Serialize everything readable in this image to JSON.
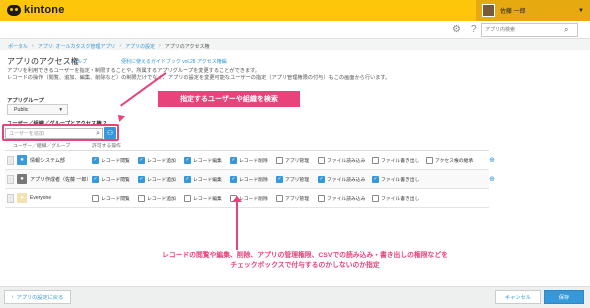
{
  "app": {
    "logo_text": "kintone"
  },
  "user": {
    "name": "佐藤 一郎",
    "caret": "▼"
  },
  "search": {
    "placeholder": "アプリ内検索",
    "icon": "search-icon"
  },
  "breadcrumb": {
    "items": [
      "ポータル",
      "アプリ: オールカタスク管理アプリ",
      "アプリの設定",
      "アプリのアクセス権"
    ],
    "separator": "›"
  },
  "page": {
    "title": "アプリのアクセス権",
    "help_link": "ヘルプ",
    "guide_link": "便利に使えるガイドブック vol.28 アクセス権編",
    "description_line1": "アプリを利用できるユーザーを指定・制限することや、所属するアプリグループを変更することができます。",
    "description_line2": "レコードの操作（閲覧、追加、編集、削除など）の制限だけでなく、アプリの設定を変更可能なユーザーの指定（アプリ管理権限の付与）もこの画面から行います。"
  },
  "app_group": {
    "label": "アプリグループ",
    "value": "Public",
    "caret": "▾"
  },
  "access_section": {
    "label": "ユーザー／組織／グループとアクセス権 ?"
  },
  "user_search": {
    "placeholder": "ユーザーを追加",
    "icon": "search-icon"
  },
  "callout1": "指定するユーザーや組織を検索",
  "table": {
    "headers": [
      "ユーザー／組織／グループ",
      "許可する操作"
    ],
    "rows": [
      {
        "name": "情報システム部",
        "icon_color": "#3d9ad8",
        "perms": [
          {
            "label": "レコード閲覧",
            "checked": true
          },
          {
            "label": "レコード追加",
            "checked": true
          },
          {
            "label": "レコード編集",
            "checked": true
          },
          {
            "label": "レコード削除",
            "checked": true
          },
          {
            "label": "アプリ管理",
            "checked": false
          },
          {
            "label": "ファイル読み込み",
            "checked": false
          },
          {
            "label": "ファイル書き出し",
            "checked": false
          },
          {
            "label": "アクセス権の継承",
            "checked": false
          }
        ]
      },
      {
        "name": "アプリ作成者（佐藤 一郎）",
        "icon_color": "#777777",
        "perms": [
          {
            "label": "レコード閲覧",
            "checked": true
          },
          {
            "label": "レコード追加",
            "checked": true
          },
          {
            "label": "レコード編集",
            "checked": true
          },
          {
            "label": "レコード削除",
            "checked": true
          },
          {
            "label": "アプリ管理",
            "checked": true
          },
          {
            "label": "ファイル読み込み",
            "checked": true
          },
          {
            "label": "ファイル書き出し",
            "checked": true
          }
        ]
      },
      {
        "name": "Everyone",
        "icon_color": "#f0e3b0",
        "perms": [
          {
            "label": "レコード閲覧",
            "checked": false
          },
          {
            "label": "レコード追加",
            "checked": false
          },
          {
            "label": "レコード編集",
            "checked": false
          },
          {
            "label": "レコード削除",
            "checked": false
          },
          {
            "label": "アプリ管理",
            "checked": false
          },
          {
            "label": "ファイル読み込み",
            "checked": false
          },
          {
            "label": "ファイル書き出し",
            "checked": false
          }
        ]
      }
    ]
  },
  "callout2_line1": "レコードの閲覧や編集、削除、アプリの管理権限、CSVでの読み込み・書き出しの権限などを",
  "callout2_line2": "チェックボックスで付与するのかしないのか指定",
  "footer": {
    "back_label": "アプリの設定に戻る",
    "cancel_label": "キャンセル",
    "save_label": "保存"
  },
  "colors": {
    "accent": "#3498db",
    "topbar": "#fdc60b",
    "highlight": "#e8437a"
  }
}
